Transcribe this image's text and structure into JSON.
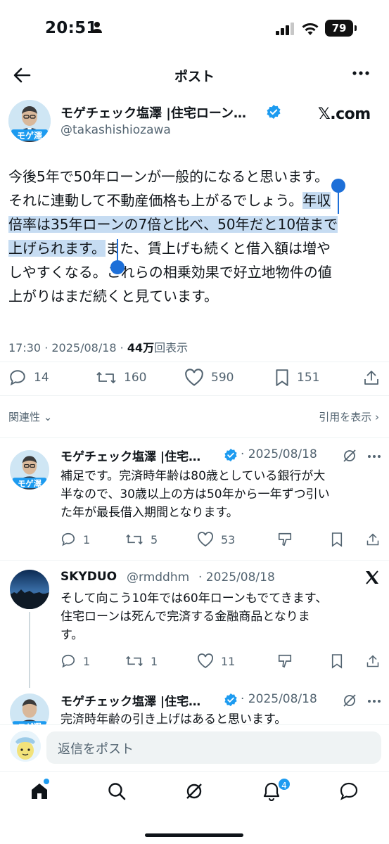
{
  "status_bar": {
    "time": "20:51",
    "battery": "79"
  },
  "header": {
    "title": "ポスト"
  },
  "post": {
    "author_name": "モゲチェック塩澤 |住宅ローン…",
    "handle": "@takashishiozawa",
    "avatar_label": "モゲ澤",
    "source_logo": "𝕏.com",
    "body_lines": [
      {
        "pre": "今後5年で50年ローンが一般的になると思います。",
        "hl": "",
        "post": ""
      },
      {
        "pre": "それに連動して不動産価格も上がるでしょう。",
        "hl": "年収",
        "post": ""
      },
      {
        "pre": "",
        "hl": "倍率は35年ローンの7倍と比べ、50年だと10倍まで",
        "post": ""
      },
      {
        "pre": "",
        "hl": "上げられます。",
        "post": "また、賃上げも続くと借入額は増や"
      },
      {
        "pre": "しやすくなる。これらの相乗効果で好立地物件の値",
        "hl": "",
        "post": ""
      },
      {
        "pre": "上がりはまだ続くと見ています。",
        "hl": "",
        "post": ""
      }
    ],
    "timestamp": "17:30 · 2025/08/18 · ",
    "views_count": "44万",
    "views_label": "回表示",
    "actions": {
      "replies": "14",
      "reposts": "160",
      "likes": "590",
      "bookmarks": "151"
    }
  },
  "filters": {
    "relevance": "関連性",
    "quotes": "引用を表示"
  },
  "replies": [
    {
      "name": "モゲチェック塩澤 |住宅…",
      "meta": "· 2025/08/18",
      "avatar_label": "モゲ澤",
      "lines": [
        "補足です。完済時年齢は80歳としている銀行が大",
        "半なので、30歳以上の方は50年から一年ずつ引い",
        "た年が最長借入期間となります。"
      ],
      "replies": "1",
      "reposts": "5",
      "likes": "53"
    },
    {
      "name": "SKYDUO",
      "handle": "@rmddhm",
      "meta": "· 2025/08/18",
      "lines": [
        "そして向こう10年では60年ローンもでてきます、",
        "住宅ローンは死んで完済する金融商品となりま",
        "す。"
      ],
      "replies": "1",
      "reposts": "1",
      "likes": "11"
    },
    {
      "name": "モゲチェック塩澤 |住宅…",
      "meta": "· 2025/08/18",
      "avatar_label": "モゲ澤",
      "lines": [
        "完済時年齢の引き上げはあると思います。"
      ]
    }
  ],
  "composer": {
    "placeholder": "返信をポスト"
  },
  "nav": {
    "notification_count": "4"
  },
  "colors": {
    "accent": "#1d9bf0",
    "selection": "#c6dcf2",
    "handle": "#1d6fd8"
  }
}
